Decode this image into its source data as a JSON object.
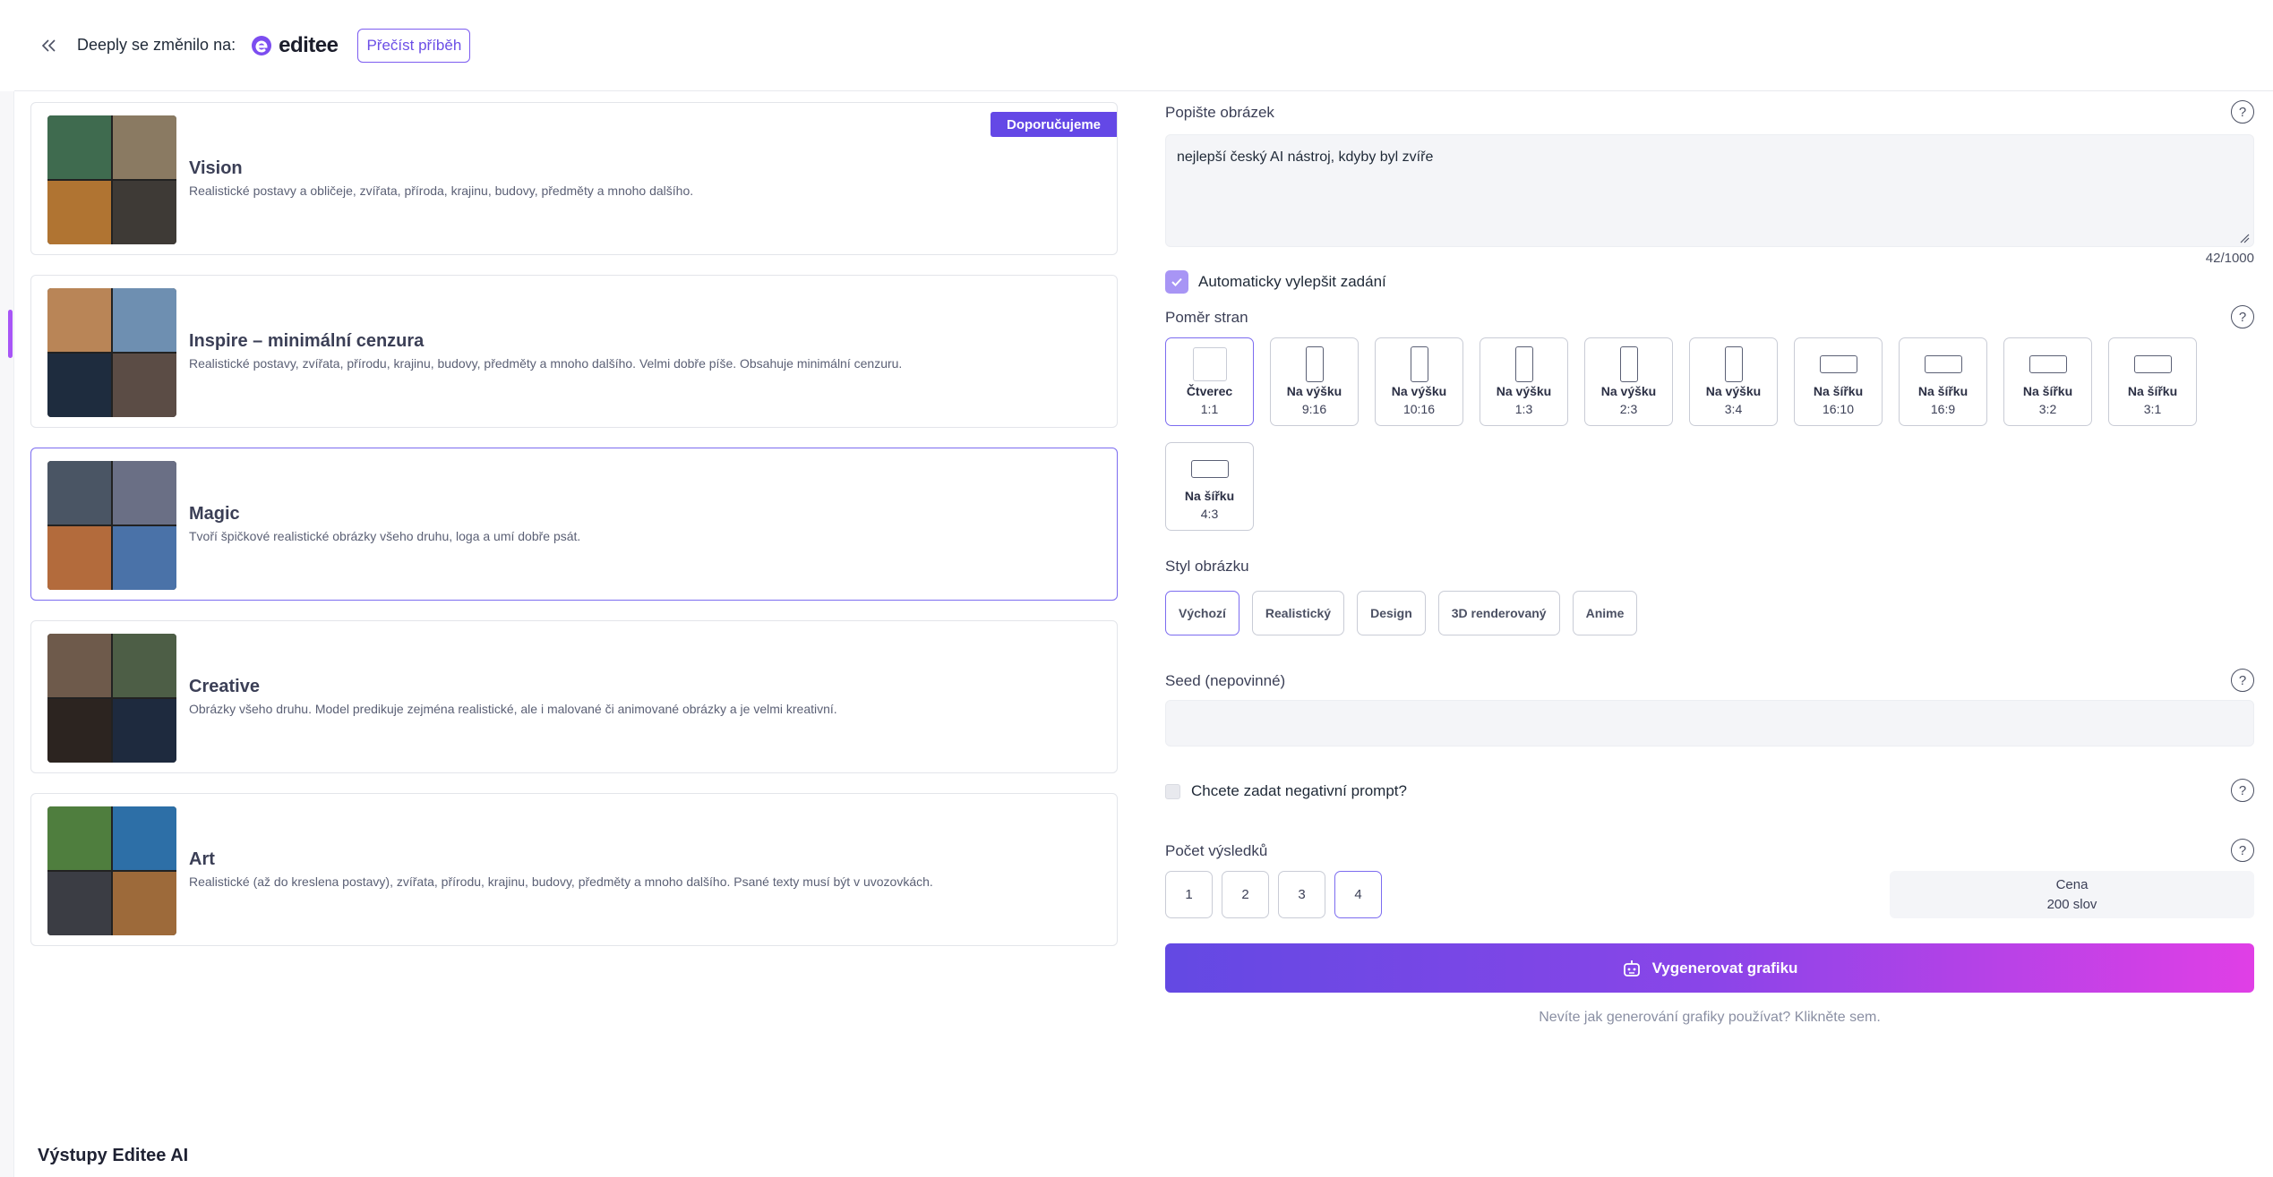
{
  "header": {
    "notice": "Deeply se změnilo na:",
    "brand": "editee",
    "story_button": "Přečíst příběh"
  },
  "models": [
    {
      "title": "Vision",
      "description": "Realistické postavy a obličeje, zvířata, příroda, krajinu, budovy, předměty a mnoho dalšího.",
      "badge": "Doporučujeme",
      "thumb_colors": [
        "#3f6b4f",
        "#8a7a62",
        "#b07432",
        "#3e3a36"
      ]
    },
    {
      "title": "Inspire – minimální cenzura",
      "description": "Realistické postavy, zvířata, přírodu, krajinu, budovy, předměty a mnoho dalšího. Velmi dobře píše. Obsahuje minimální cenzuru.",
      "thumb_colors": [
        "#b98557",
        "#6e8fb1",
        "#1e2c3e",
        "#5b4c45"
      ]
    },
    {
      "title": "Magic",
      "description": "Tvoří špičkové realistické obrázky všeho druhu, loga a umí dobře psát.",
      "thumb_colors": [
        "#4a5564",
        "#6a6f85",
        "#b36b3c",
        "#4a72a8"
      ]
    },
    {
      "title": "Creative",
      "description": "Obrázky všeho druhu. Model predikuje zejména realistické, ale i malované či animované obrázky a je velmi kreativní.",
      "thumb_colors": [
        "#6e5a4b",
        "#4d5e46",
        "#2c2420",
        "#1e2a3e"
      ]
    },
    {
      "title": "Art",
      "description": "Realistické (až do kreslena postavy), zvířata, přírodu, krajinu, budovy, předměty a mnoho dalšího. Psané texty musí být v uvozovkách.",
      "thumb_colors": [
        "#4f7e3e",
        "#2d6fa7",
        "#3b3d44",
        "#9d6a3a"
      ]
    }
  ],
  "form": {
    "describe_label": "Popište obrázek",
    "prompt_value": "nejlepší český AI nástroj, kdyby byl zvíře",
    "char_counter": "42/1000",
    "auto_improve_label": "Automaticky vylepšit zadání",
    "aspect_label": "Poměr stran",
    "aspects": [
      {
        "name": "Čtverec",
        "ratio": "1:1",
        "orient": "square",
        "selected": true
      },
      {
        "name": "Na výšku",
        "ratio": "9:16",
        "orient": "portrait"
      },
      {
        "name": "Na výšku",
        "ratio": "10:16",
        "orient": "portrait"
      },
      {
        "name": "Na výšku",
        "ratio": "1:3",
        "orient": "portrait"
      },
      {
        "name": "Na výšku",
        "ratio": "2:3",
        "orient": "portrait"
      },
      {
        "name": "Na výšku",
        "ratio": "3:4",
        "orient": "portrait"
      },
      {
        "name": "Na šířku",
        "ratio": "16:10",
        "orient": "landscape"
      },
      {
        "name": "Na šířku",
        "ratio": "16:9",
        "orient": "landscape"
      },
      {
        "name": "Na šířku",
        "ratio": "3:2",
        "orient": "landscape"
      },
      {
        "name": "Na šířku",
        "ratio": "3:1",
        "orient": "landscape"
      },
      {
        "name": "Na šířku",
        "ratio": "4:3",
        "orient": "landscape"
      }
    ],
    "style_label": "Styl obrázku",
    "styles": [
      {
        "label": "Výchozí",
        "selected": true
      },
      {
        "label": "Realistický"
      },
      {
        "label": "Design"
      },
      {
        "label": "3D renderovaný"
      },
      {
        "label": "Anime"
      }
    ],
    "seed_label": "Seed (nepovinné)",
    "seed_value": "",
    "negative_label": "Chcete zadat negativní prompt?",
    "count_label": "Počet výsledků",
    "counts": [
      "1",
      "2",
      "3",
      "4"
    ],
    "selected_count": "4",
    "price_label": "Cena",
    "price_value": "200 slov",
    "generate_button": "Vygenerovat grafiku",
    "help_link": "Nevíte jak generování grafiky používat? Klikněte sem."
  },
  "outputs_title": "Výstupy Editee AI",
  "colors": {
    "accent": "#6448e6",
    "gradient_start": "#6349e3",
    "gradient_end": "#e03fe6",
    "selected_border": "#7c6cf0"
  }
}
